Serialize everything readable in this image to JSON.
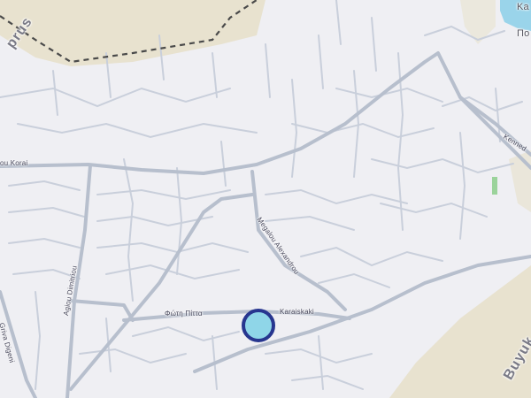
{
  "map": {
    "colors": {
      "land": "#efeff3",
      "hills": "#e8e2cf",
      "water": "#9ad4ea",
      "road_major": "#b7bfcd",
      "road_minor": "#c9cfdb",
      "boundary": "#4a4a4a",
      "marker_fill": "#8fd6e8",
      "marker_stroke": "#27368f"
    },
    "labels": {
      "region_top": "prus",
      "region_bottom": "Buyuk",
      "place_top_right": "Ka",
      "place_top_right_sub": "Πο",
      "kennedy": "Kenned",
      "korai": "ou Korai",
      "megalou_alexandrou": "Megalou Alexandrou",
      "agiou_dimitriou": "Agiou Dimitriou",
      "fotis_pittas": "Φώτη Πίττα",
      "karaiskaki": "Karaiskaki",
      "griva_digeni": "Griva Digeni"
    },
    "marker": {
      "name": "location-marker"
    }
  }
}
